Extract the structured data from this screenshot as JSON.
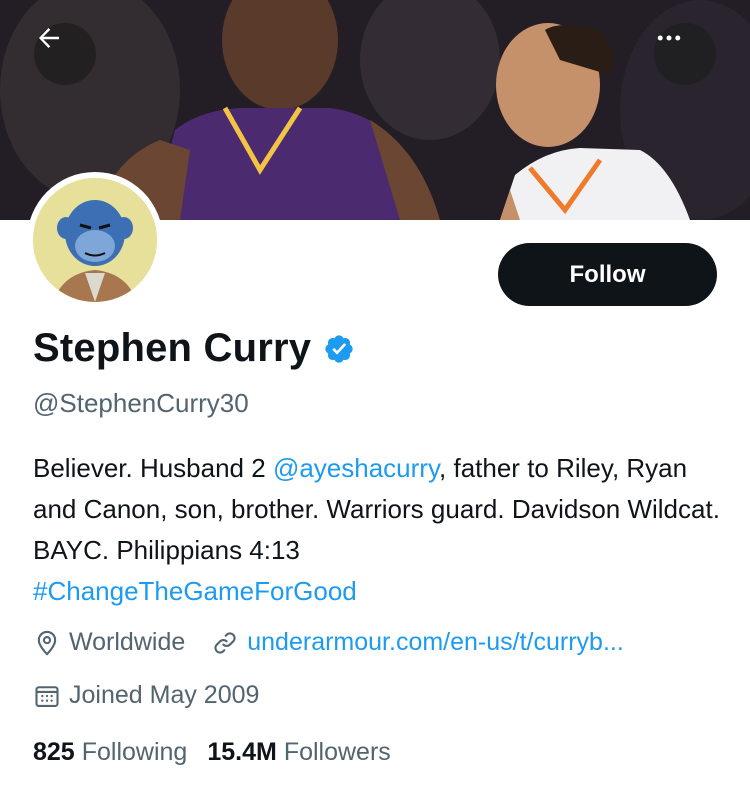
{
  "profile": {
    "display_name": "Stephen Curry",
    "handle": "@StephenCurry30",
    "follow_label": "Follow",
    "bio": {
      "part1": "Believer. Husband 2 ",
      "mention": "@ayeshacurry",
      "part2": ", father to Riley, Ryan and Canon, son, brother. Warriors guard. Davidson Wildcat. BAYC. Philippians 4:13",
      "hashtag": "#ChangeTheGameForGood"
    },
    "location": "Worldwide",
    "website": "underarmour.com/en-us/t/curryb...",
    "joined": "Joined May 2009",
    "following_count": "825",
    "following_label": "Following",
    "followers_count": "15.4M",
    "followers_label": "Followers"
  },
  "icons": {
    "back": "arrow-left-icon",
    "more": "more-horizontal-icon",
    "verified": "verified-badge-icon",
    "location": "location-pin-icon",
    "link": "link-icon",
    "calendar": "calendar-icon"
  },
  "colors": {
    "accent": "#1d9bf0",
    "text_primary": "#0f1419",
    "text_secondary": "#536471",
    "button_bg": "#0f1419"
  }
}
